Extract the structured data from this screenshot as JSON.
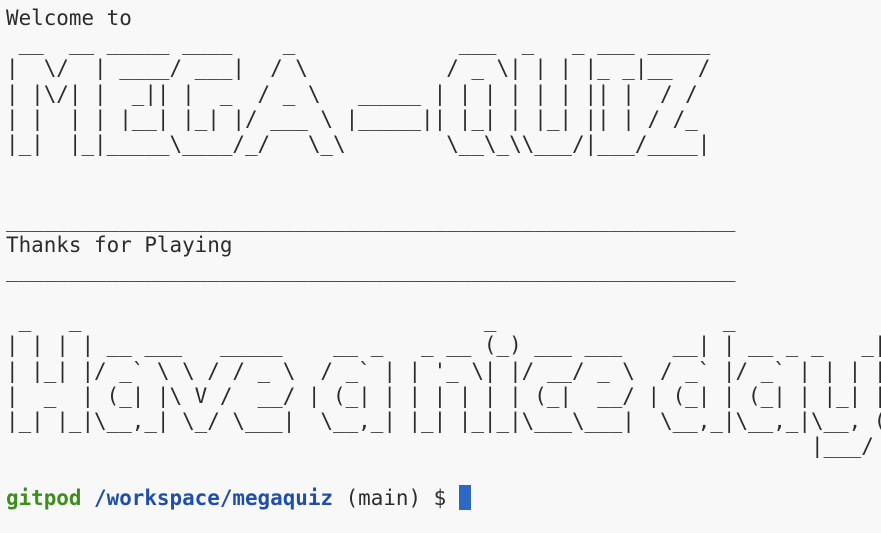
{
  "terminal": {
    "lines": [
      "Welcome to",
      " __  __ _____ ____    _             ___  _   _ ___ _____",
      "|  \\/  | ____/ ___|  / \\           / _ \\| | | |_ _|__  /",
      "| |\\/| |  _|| |  _  / _ \\   _____ | | | | | | || |  / / ",
      "| |  | | |__| |_| |/ ___ \\ |_____|| |_| | |_| || | / /_ ",
      "|_|  |_|_____\\____/_/   \\_\\        \\__\\_\\\\___/|___/____|",
      "",
      "",
      "__________________________________________________________",
      "Thanks for Playing",
      "__________________________________________________________",
      "",
      " _   _                                _                  _            _ ",
      "| | | | __ ___   _____    __ _   _ __ (_) ___ ___    __| | __ _ _   _| |",
      "| |_| |/ _` \\ \\ / / _ \\  / _` | | '_ \\| |/ __/ _ \\  / _` |/ _` | | | | |",
      "|  _  | (_| |\\ V /  __/ | (_| | | | | | | (_|  __/ | (_| | (_| | |_| |_|",
      "|_| |_|\\__,_| \\_/ \\___|  \\__,_| |_| |_|_|\\___\\___|  \\__,_|\\__,_|\\__, (_)",
      "                                                                |___/   ",
      ""
    ],
    "prompt": {
      "user": "gitpod",
      "path": "/workspace/megaquiz",
      "branch": "(main)",
      "symbol": "$"
    },
    "colors": {
      "background": "#f8f8f8",
      "text": "#2c2c2c",
      "user": "#3e8e1e",
      "path": "#1f4fa8",
      "cursor": "#2f67c4"
    }
  }
}
